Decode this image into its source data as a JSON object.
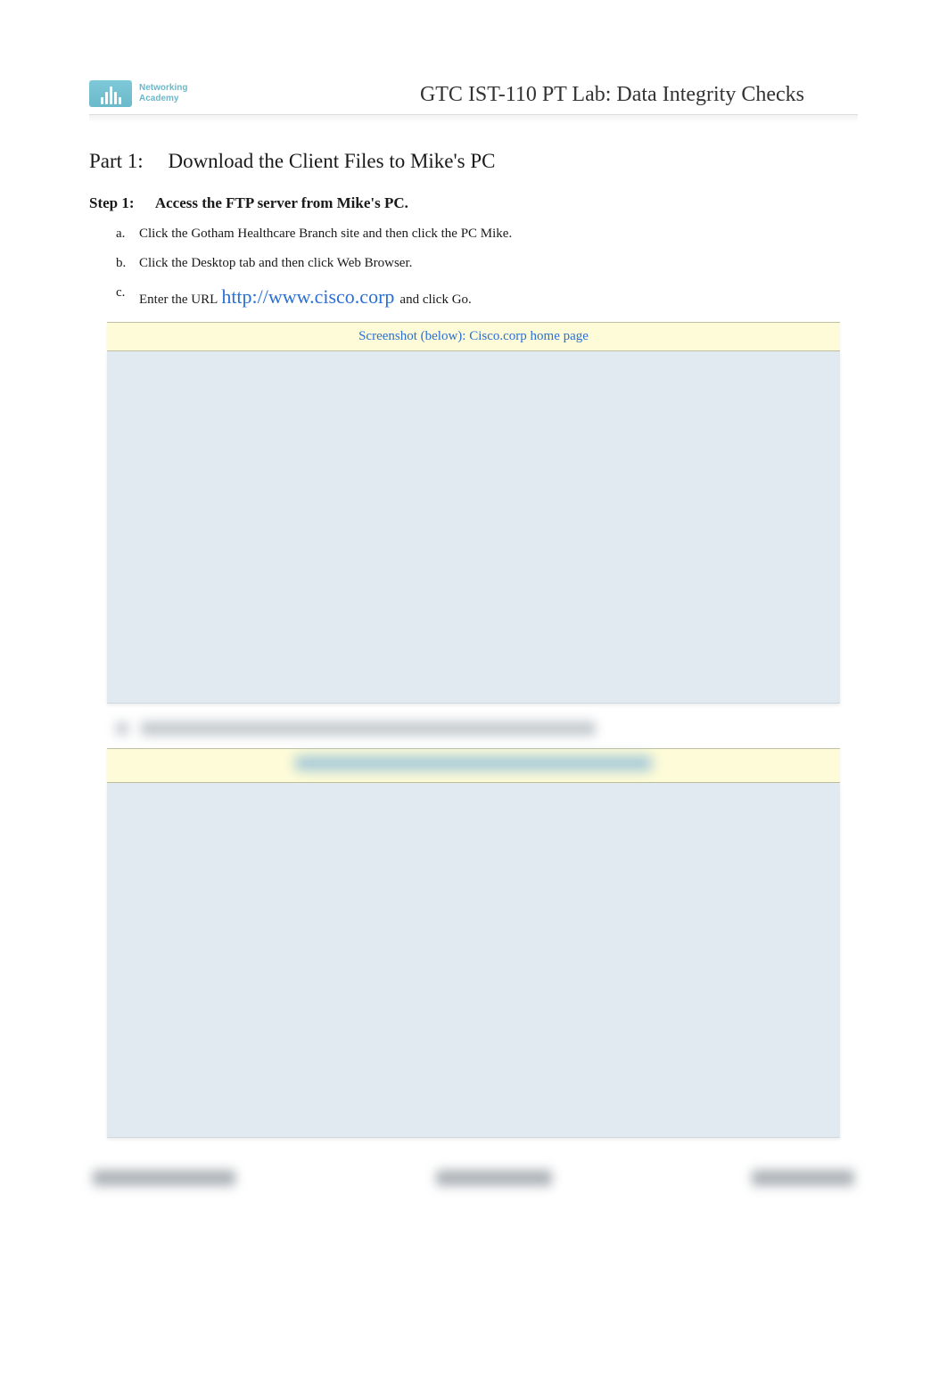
{
  "header": {
    "logo_line1": "Networking",
    "logo_line2": "Academy",
    "title": "GTC IST-110 PT Lab: Data Integrity Checks"
  },
  "part": {
    "number": "Part 1:",
    "title": "Download the Client Files to Mike's PC"
  },
  "step": {
    "number": "Step 1:",
    "title": "Access the FTP server from Mike's PC."
  },
  "items": [
    {
      "letter": "a.",
      "text": "Click the Gotham Healthcare Branch site and then click the PC Mike."
    },
    {
      "letter": "b.",
      "text": "Click the Desktop tab and then click Web Browser."
    },
    {
      "letter": "c.",
      "text_before": "Enter the URL ",
      "url": "http://www.cisco.corp",
      "text_after": " and click Go."
    }
  ],
  "captions": {
    "caption1": "Screenshot (below): Cisco.corp home page"
  }
}
